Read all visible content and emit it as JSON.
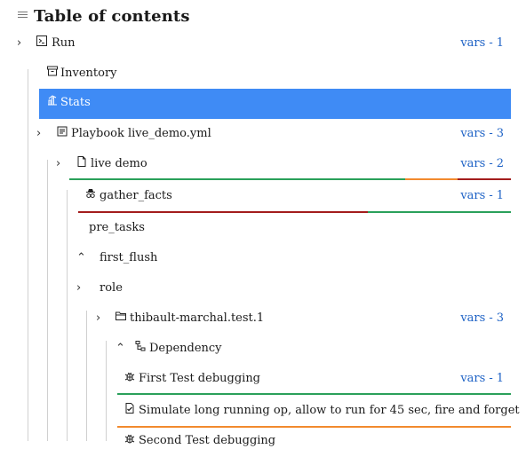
{
  "header": {
    "title": "Table of contents"
  },
  "colors": {
    "accent_selected": "#3f8bf5",
    "vars_link": "#1f63c6",
    "status_ok": "#2aa05a",
    "status_changed": "#f28a2e",
    "status_failed": "#a31c1c",
    "guide_line": "#d0d0d0"
  },
  "tree": {
    "vars_separator": "-",
    "rows": [
      {
        "id": "run",
        "label": "Run",
        "icon": "terminal-icon",
        "chevron": "›",
        "vars_label": "vars",
        "vars_count": "1"
      },
      {
        "id": "inventory",
        "label": "Inventory",
        "icon": "archive-icon"
      },
      {
        "id": "stats",
        "label": "Stats",
        "icon": "chart-icon",
        "selected": true
      },
      {
        "id": "playbook",
        "label": "Playbook live_demo.yml",
        "icon": "notebook-icon",
        "chevron": "›",
        "vars_label": "vars",
        "vars_count": "3"
      },
      {
        "id": "play",
        "label": "live demo",
        "icon": "file-icon",
        "chevron": "›",
        "vars_label": "vars",
        "vars_count": "2",
        "status_bar": [
          {
            "status": "ok",
            "fraction": 0.76
          },
          {
            "status": "changed",
            "fraction": 0.12
          },
          {
            "status": "failed",
            "fraction": 0.12
          }
        ]
      },
      {
        "id": "gather_facts",
        "label": "gather_facts",
        "icon": "spy-icon",
        "vars_label": "vars",
        "vars_count": "1",
        "status_bar": [
          {
            "status": "failed",
            "fraction": 0.67
          },
          {
            "status": "ok",
            "fraction": 0.33
          }
        ]
      },
      {
        "id": "pre_tasks",
        "label": "pre_tasks"
      },
      {
        "id": "first_flush",
        "label": "first_flush",
        "chevron": "⌃"
      },
      {
        "id": "role",
        "label": "role",
        "chevron": "›"
      },
      {
        "id": "role_name",
        "label": "thibault-marchal.test.1",
        "icon": "folder-icon",
        "chevron": "›",
        "vars_label": "vars",
        "vars_count": "3"
      },
      {
        "id": "dependency",
        "label": "Dependency",
        "icon": "hierarchy-icon",
        "chevron": "⌃"
      },
      {
        "id": "first_test",
        "label": "First Test debugging",
        "icon": "bug-icon",
        "vars_label": "vars",
        "vars_count": "1",
        "status_bar": [
          {
            "status": "ok",
            "fraction": 1.0
          }
        ]
      },
      {
        "id": "simulate",
        "label": "Simulate long running op, allow to run for 45 sec, fire and forget",
        "icon": "task-file-icon",
        "status_bar": [
          {
            "status": "changed",
            "fraction": 1.0
          }
        ]
      },
      {
        "id": "second_test",
        "label": "Second Test debugging",
        "icon": "bug-icon"
      }
    ]
  }
}
